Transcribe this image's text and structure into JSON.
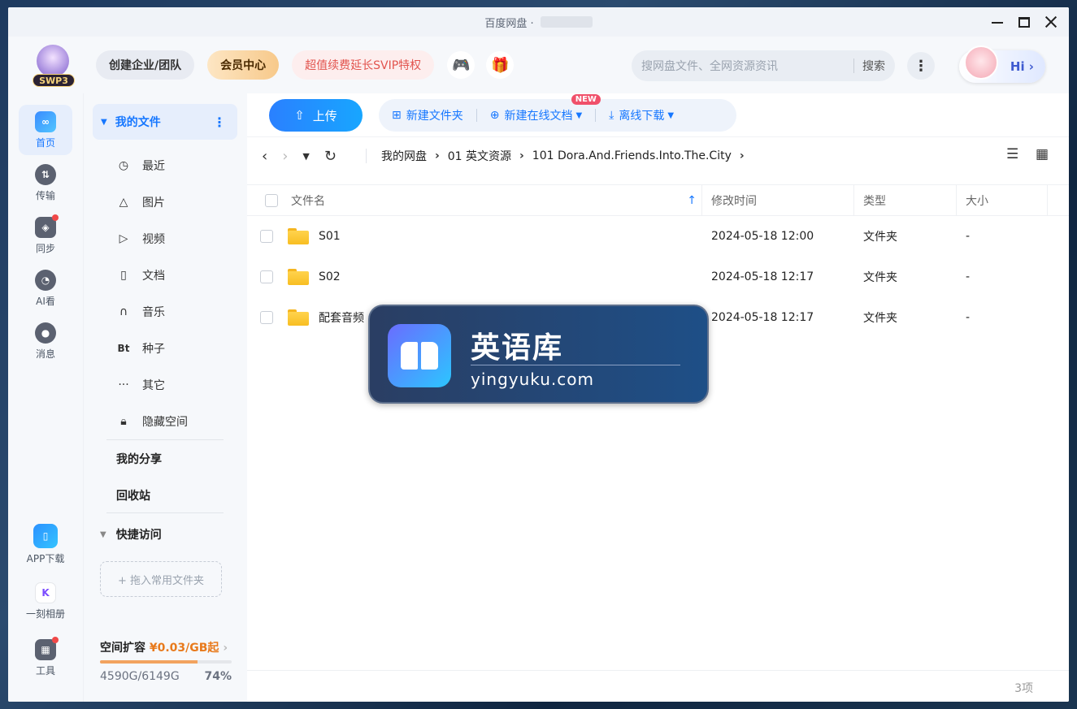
{
  "window": {
    "title": "百度网盘 ·"
  },
  "topbar": {
    "vip_badge": "SWP3",
    "team_label": "创建企业/团队",
    "member_label": "会员中心",
    "svip_label": "超值续费延长SVIP特权",
    "search_placeholder": "搜网盘文件、全网资源资讯",
    "search_button": "搜索",
    "hi_label": "Hi ›"
  },
  "rail": {
    "items": [
      {
        "label": "首页"
      },
      {
        "label": "传输"
      },
      {
        "label": "同步"
      },
      {
        "label": "AI看"
      },
      {
        "label": "消息"
      },
      {
        "label": "APP下载"
      },
      {
        "label": "一刻相册"
      },
      {
        "label": "工具"
      }
    ]
  },
  "sidebar": {
    "my_files": "我的文件",
    "items": [
      {
        "label": "最近",
        "icon": "clock-icon"
      },
      {
        "label": "图片",
        "icon": "image-icon"
      },
      {
        "label": "视频",
        "icon": "play-icon"
      },
      {
        "label": "文档",
        "icon": "document-icon"
      },
      {
        "label": "音乐",
        "icon": "headphones-icon"
      },
      {
        "label": "种子",
        "icon": "bt-icon"
      },
      {
        "label": "其它",
        "icon": "more-icon"
      },
      {
        "label": "隐藏空间",
        "icon": "lock-icon"
      }
    ],
    "my_share": "我的分享",
    "recycle": "回收站",
    "quick_access": "快捷访问",
    "drop_hint": "+ 拖入常用文件夹",
    "quota": {
      "title": "空间扩容",
      "price": "¥0.03/GB起",
      "used": "4590G/6149G",
      "percent_label": "74%",
      "percent": 74
    }
  },
  "toolbar": {
    "upload": "上传",
    "new_folder": "新建文件夹",
    "new_online_doc": "新建在线文档",
    "new_badge": "NEW",
    "offline_download": "离线下载"
  },
  "breadcrumb": {
    "parts": [
      "我的网盘",
      "01 英文资源",
      "101 Dora.And.Friends.Into.The.City"
    ]
  },
  "table": {
    "headers": {
      "name": "文件名",
      "modified": "修改时间",
      "type": "类型",
      "size": "大小"
    },
    "rows": [
      {
        "name": "S01",
        "modified": "2024-05-18 12:00",
        "type": "文件夹",
        "size": "-"
      },
      {
        "name": "S02",
        "modified": "2024-05-18 12:17",
        "type": "文件夹",
        "size": "-"
      },
      {
        "name": "配套音频",
        "modified": "2024-05-18 12:17",
        "type": "文件夹",
        "size": "-"
      }
    ],
    "count": "3项"
  },
  "watermark": {
    "title": "英语库",
    "url": "yingyuku.com"
  },
  "colors": {
    "accent": "#1677ff",
    "quota_fill": "#f2a35f",
    "price": "#e87a1c"
  }
}
